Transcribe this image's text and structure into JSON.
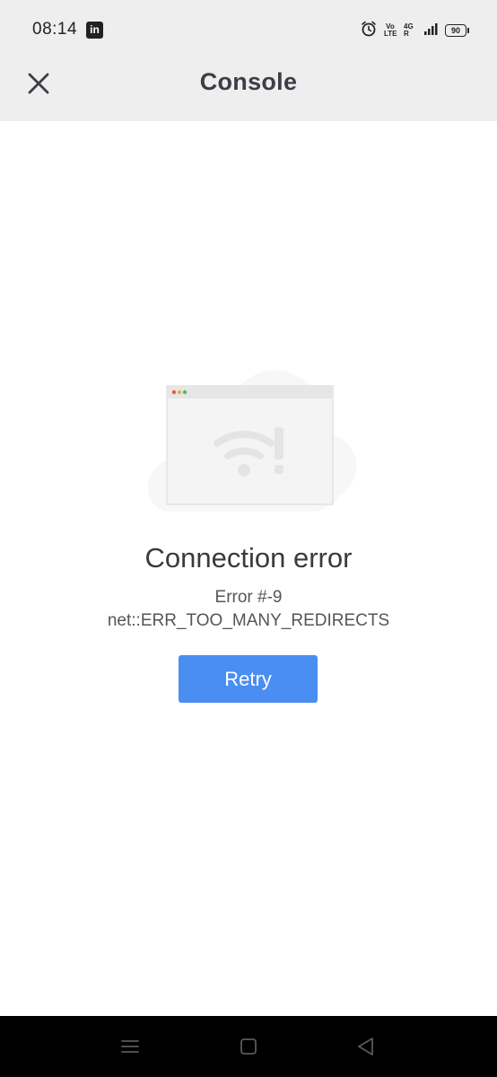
{
  "status_bar": {
    "time": "08:14",
    "app_icon": "linkedin-icon",
    "alarm_icon": "alarm-icon",
    "volte_label": "Vo LTE",
    "network_label": "4G R",
    "signal_icon": "signal-icon",
    "battery_level": "90"
  },
  "app_bar": {
    "title": "Console",
    "close_icon": "close-icon"
  },
  "error": {
    "illustration_icon": "no-connection-browser-illustration",
    "title": "Connection error",
    "code": "Error #-9",
    "message": "net::ERR_TOO_MANY_REDIRECTS",
    "retry_label": "Retry"
  },
  "nav_bar": {
    "items": [
      "menu-icon",
      "home-icon",
      "back-icon"
    ]
  },
  "colors": {
    "accent": "#4a8ef2",
    "header_bg": "#eeeeee",
    "nav_bg": "#000000"
  }
}
